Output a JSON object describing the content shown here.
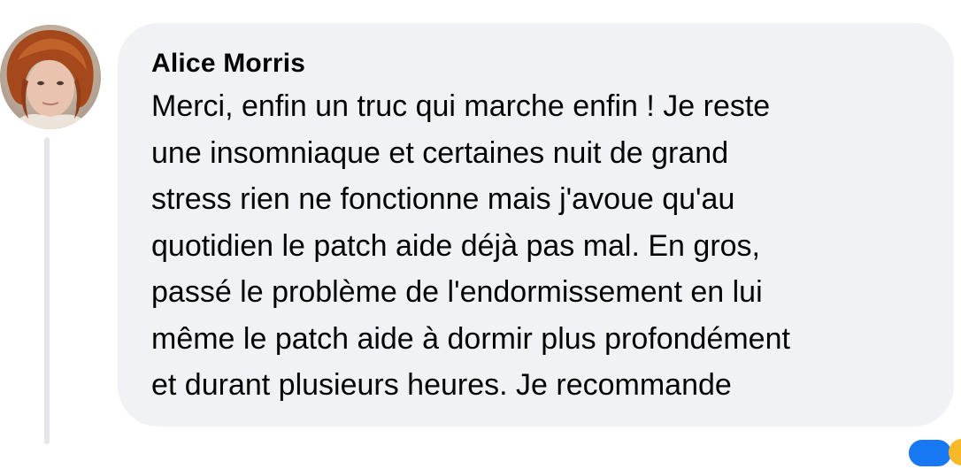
{
  "comment": {
    "author": "Alice Morris",
    "text": "Merci, enfin un truc qui marche enfin ! Je reste\nune insomniaque et certaines nuit de grand\nstress rien ne fonctionne mais j'avoue qu'au\nquotidien le patch aide déjà pas mal. En gros,\npassé le problème de l'endormissement en lui\nmême le patch aide à dormir plus profondément\net durant plusieurs heures. Je recommande"
  },
  "colors": {
    "bubble_background": "#f0f2f5",
    "text": "#050505",
    "thread_line": "#e4e6eb",
    "reaction_like": "#1877f2",
    "reaction_haha": "#f7b928"
  },
  "icons": {
    "avatar": "profile-photo",
    "reactions": [
      "like-reaction-icon",
      "haha-reaction-icon"
    ]
  }
}
